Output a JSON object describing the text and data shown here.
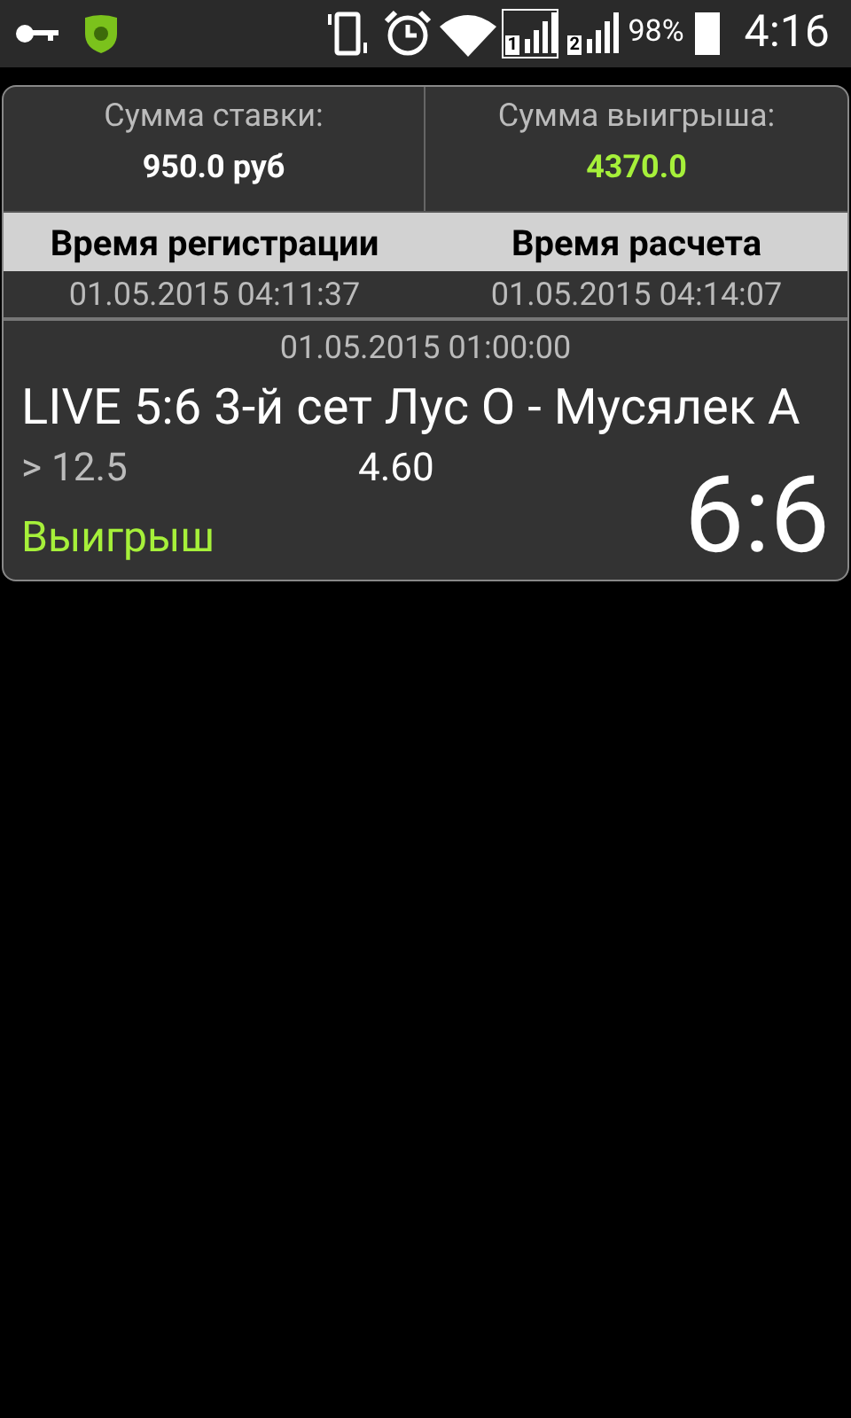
{
  "status_bar": {
    "sim_slots": [
      {
        "label": "1",
        "selected": true
      },
      {
        "label": "2",
        "selected": false
      }
    ],
    "battery": "98%",
    "time": "4:16"
  },
  "bet": {
    "stake_label": "Сумма ставки:",
    "stake": "950.0 руб",
    "payout_label": "Сумма выигрыша:",
    "payout": "4370.0",
    "registration_header": "Время регистрации",
    "settlement_header": "Время расчета",
    "registration_time": "01.05.2015 04:11:37",
    "settlement_time": "01.05.2015 04:14:07",
    "event_time": "01.05.2015 01:00:00",
    "event": "LIVE 5:6 3-й сет Лус О - Мусялек А",
    "outcome": "> 12.5",
    "odds": "4.60",
    "result": "Выигрыш",
    "score": "6:6"
  }
}
